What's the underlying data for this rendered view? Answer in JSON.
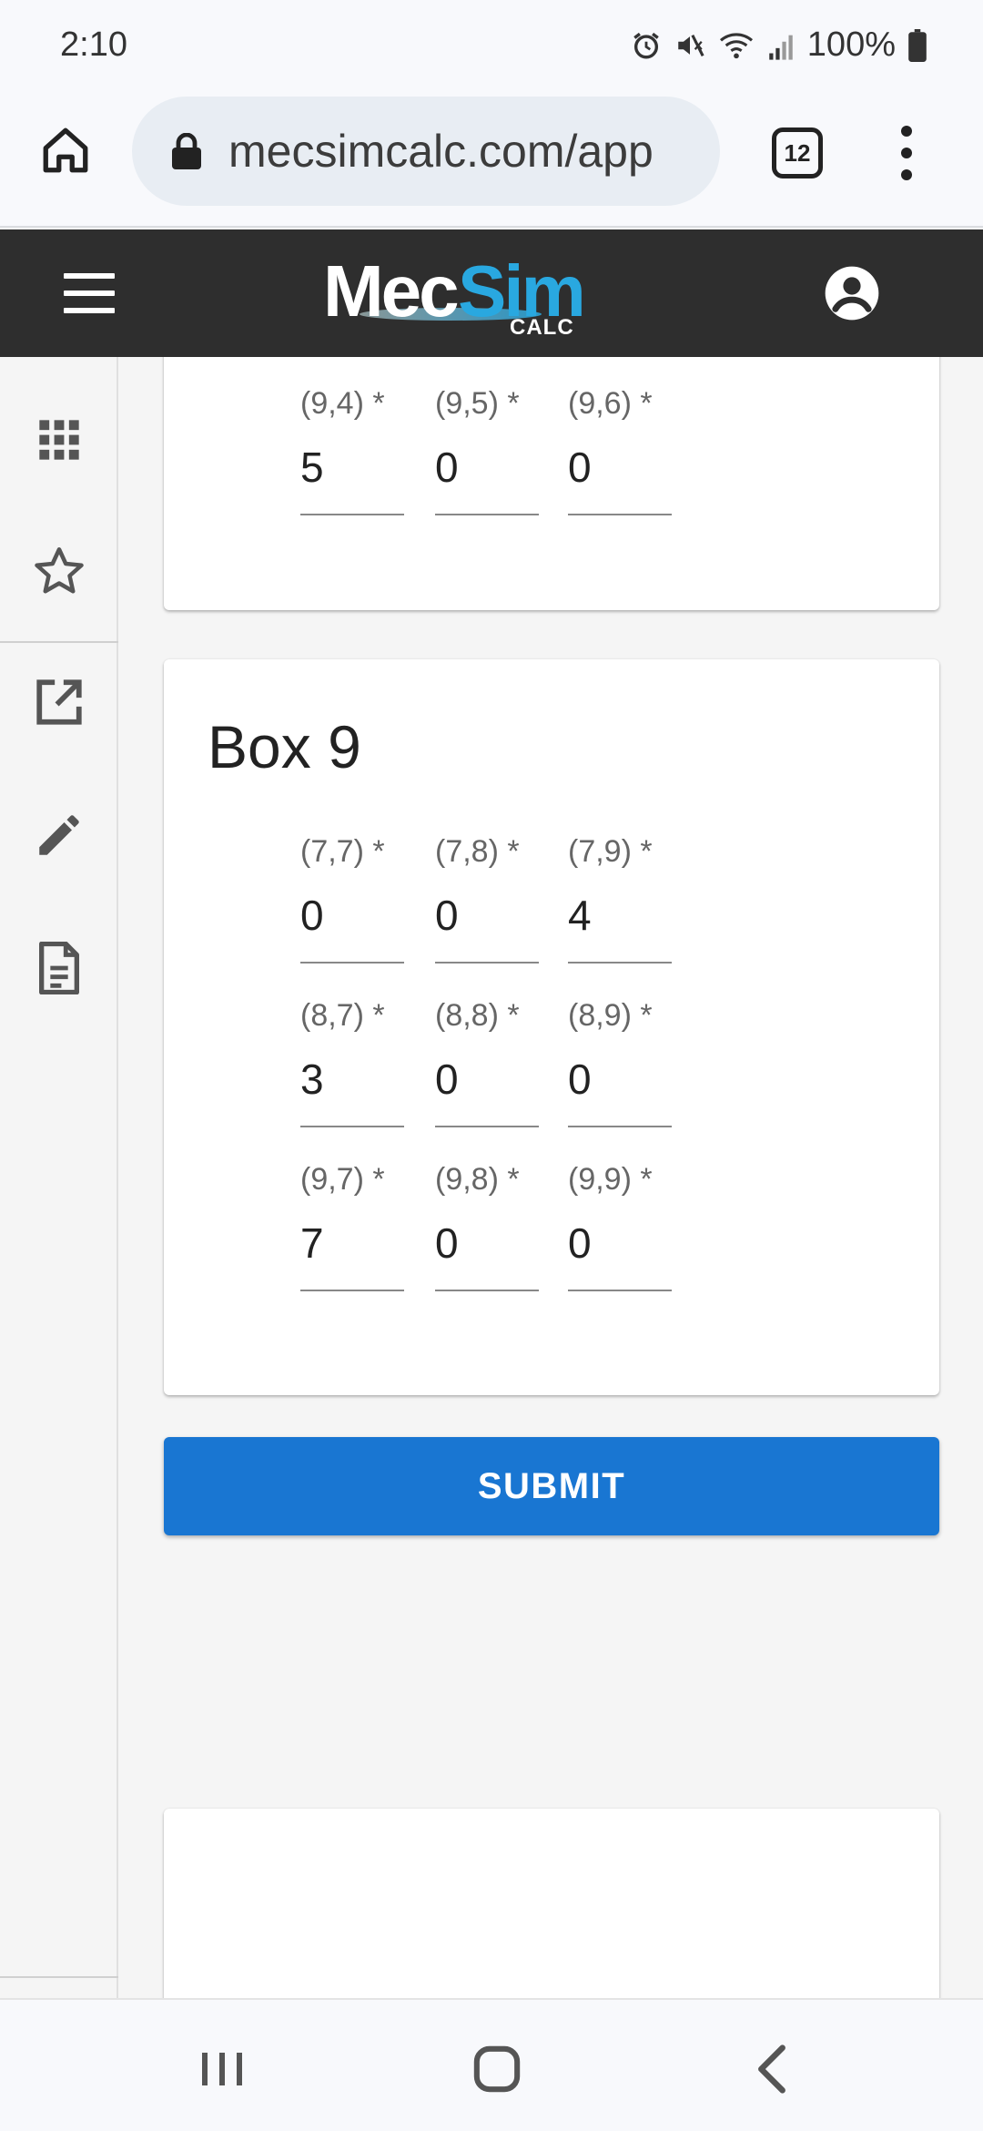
{
  "status_bar": {
    "time": "2:10",
    "battery": "100%",
    "icons": [
      "alarm-icon",
      "mute-icon",
      "wifi-icon",
      "signal-icon",
      "battery-icon"
    ]
  },
  "browser": {
    "url": "mecsimcalc.com/app",
    "tab_count": "12"
  },
  "app_header": {
    "logo_text_1": "Mec",
    "logo_text_2": "Sim",
    "logo_sub": "CALC",
    "accent_color": "#29a8e0",
    "background_color": "#2e2e2e"
  },
  "sidebar": {
    "items": [
      "apps-grid-icon",
      "star-icon",
      "open-in-new-icon",
      "edit-icon",
      "document-icon"
    ]
  },
  "partial_box": {
    "fields": [
      {
        "label": "(9,4) *",
        "value": "5"
      },
      {
        "label": "(9,5) *",
        "value": "0"
      },
      {
        "label": "(9,6) *",
        "value": "0"
      }
    ]
  },
  "box9": {
    "title": "Box 9",
    "rows": [
      [
        {
          "label": "(7,7) *",
          "value": "0"
        },
        {
          "label": "(7,8) *",
          "value": "0"
        },
        {
          "label": "(7,9) *",
          "value": "4"
        }
      ],
      [
        {
          "label": "(8,7) *",
          "value": "3"
        },
        {
          "label": "(8,8) *",
          "value": "0"
        },
        {
          "label": "(8,9) *",
          "value": "0"
        }
      ],
      [
        {
          "label": "(9,7) *",
          "value": "7"
        },
        {
          "label": "(9,8) *",
          "value": "0"
        },
        {
          "label": "(9,9) *",
          "value": "0"
        }
      ]
    ]
  },
  "submit": {
    "label": "SUBMIT",
    "color": "#1976d2"
  },
  "navbar": {
    "items": [
      "recent-apps-icon",
      "home-icon",
      "back-icon"
    ]
  }
}
